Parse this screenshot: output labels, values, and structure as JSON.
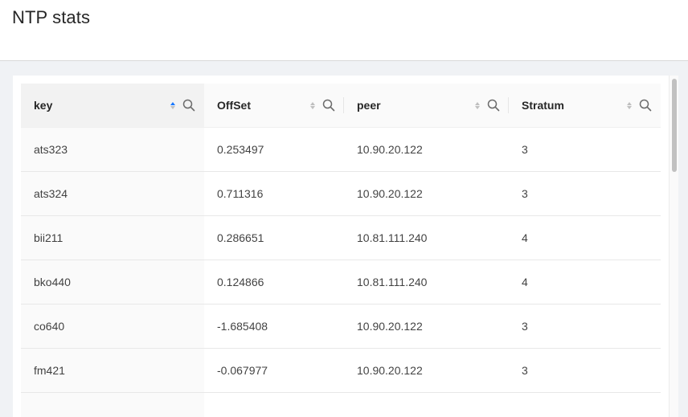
{
  "page": {
    "title": "NTP stats"
  },
  "table": {
    "columns": [
      {
        "key": "key",
        "label": "key"
      },
      {
        "key": "offset",
        "label": "OffSet"
      },
      {
        "key": "peer",
        "label": "peer"
      },
      {
        "key": "stratum",
        "label": "Stratum"
      }
    ],
    "sorted_column": "key",
    "sort_direction": "ascending",
    "rows": [
      {
        "key": "ats323",
        "offset": "0.253497",
        "peer": "10.90.20.122",
        "stratum": "3"
      },
      {
        "key": "ats324",
        "offset": "0.711316",
        "peer": "10.90.20.122",
        "stratum": "3"
      },
      {
        "key": "bii211",
        "offset": "0.286651",
        "peer": "10.81.111.240",
        "stratum": "4"
      },
      {
        "key": "bko440",
        "offset": "0.124866",
        "peer": "10.81.111.240",
        "stratum": "4"
      },
      {
        "key": "co640",
        "offset": "-1.685408",
        "peer": "10.90.20.122",
        "stratum": "3"
      },
      {
        "key": "fm421",
        "offset": "-0.067977",
        "peer": "10.90.20.122",
        "stratum": "3"
      }
    ]
  },
  "icons": {
    "filter": "search-icon",
    "sort": "sort-caret-icon"
  },
  "colors": {
    "sort_active": "#1677ff",
    "header_bg": "#fafafa",
    "page_bg": "#f0f2f5"
  }
}
